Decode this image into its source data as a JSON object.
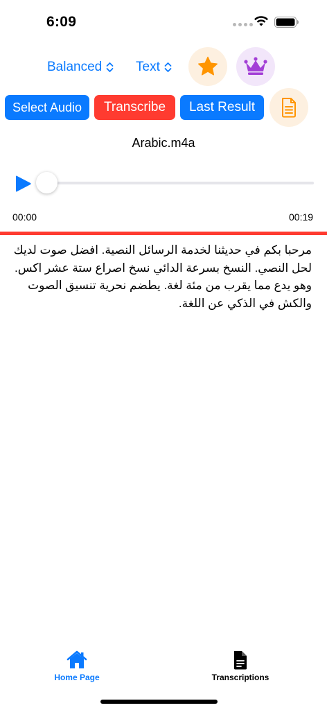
{
  "status": {
    "time": "6:09"
  },
  "toolbar": {
    "mode_picker": "Balanced",
    "format_picker": "Text",
    "favorite_icon": "star-icon",
    "premium_icon": "crown-icon"
  },
  "actions": {
    "select_audio": "Select Audio",
    "transcribe": "Transcribe",
    "last_result": "Last Result",
    "document_icon": "document-icon"
  },
  "player": {
    "filename": "Arabic.m4a",
    "current_time": "00:00",
    "duration": "00:19",
    "progress": 0
  },
  "transcript": {
    "text": "مرحبا بكم في حديثنا لخدمة الرسائل النصية. افضل صوت لديك لحل النصي. النسخ بسرعة الدائي نسخ اصراع ستة عشر اكس. وهو يدع مما يقرب من مئة لغة. يطضم نحرية تنسيق الصوت والكش في الذكي عن اللغة."
  },
  "tabbar": {
    "home": "Home Page",
    "transcriptions": "Transcriptions"
  },
  "colors": {
    "accent": "#0a7aff",
    "destructive": "#ff3b30",
    "star": "#ff9500",
    "crown": "#a33fd6"
  }
}
